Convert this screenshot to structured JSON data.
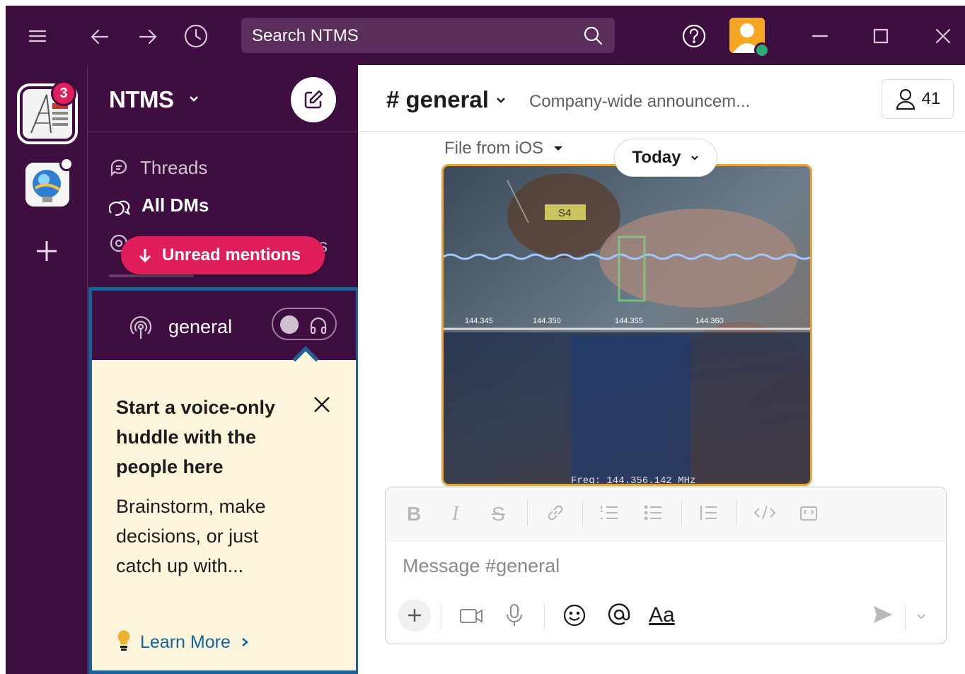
{
  "search": {
    "placeholder": "Search NTMS"
  },
  "workspace": {
    "name": "NTMS",
    "badge_count": "3"
  },
  "sidebar": {
    "items": [
      {
        "label": "Threads"
      },
      {
        "label": "All DMs"
      }
    ],
    "unread_label": "Unread mentions",
    "channel": "general"
  },
  "tip": {
    "title": "Start a voice-only huddle with the people here",
    "body": "Brainstorm, make decisions, or just catch up with...",
    "link": "Learn More"
  },
  "channel": {
    "name": "# general",
    "topic": "Company-wide announcem...",
    "member_count": "41"
  },
  "feed": {
    "file_label": "File from iOS",
    "date_pill": "Today",
    "photo_label": "S4",
    "photo_freq": "Freq: 144.356.142 MHz",
    "photo_ticks": [
      "144.345",
      "144.350",
      "144.355",
      "144.360"
    ]
  },
  "composer": {
    "placeholder": "Message #general",
    "format_label": "Aa"
  },
  "colors": {
    "aubergine": "#3f0e40",
    "mention_red": "#e01e5a",
    "presence_green": "#2bac76",
    "tip_border": "#1d5f96",
    "tip_bg": "#fdf4dc",
    "link_blue": "#1264a3"
  }
}
